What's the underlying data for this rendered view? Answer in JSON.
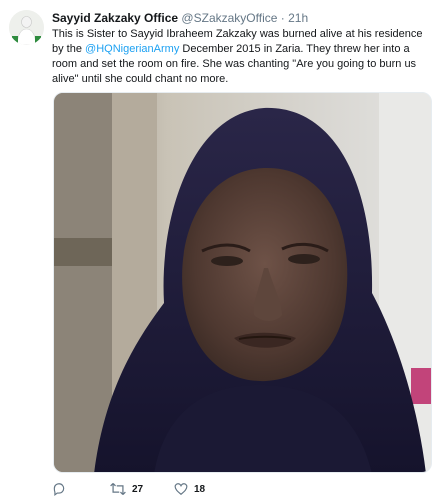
{
  "tweet": {
    "avatar_icon": "profile-picture-icon",
    "author_name": "Sayyid Zakzaky Office",
    "author_handle": "@SZakzakyOffice",
    "separator": "·",
    "timestamp": "21h",
    "text_parts": {
      "part1": "This is Sister to Sayyid Ibraheem Zakzaky was burned alive at his residence by the ",
      "mention": "@HQNigerianArmy",
      "part2": " December 2015 in Zaria. They threw her into a room and set the room on fire. She was chanting \"Are you going to burn us alive\" until she could chant no more."
    },
    "media_description_icon": "photo-of-woman-in-dark-hijab",
    "actions": {
      "reply_icon": "reply-icon",
      "retweet_icon": "retweet-icon",
      "retweet_count": "27",
      "like_icon": "heart-icon",
      "like_count": "18"
    }
  },
  "colors": {
    "link": "#1da1f2",
    "muted": "#657786",
    "text": "#14171a",
    "hijab": "#1c1a3a"
  }
}
